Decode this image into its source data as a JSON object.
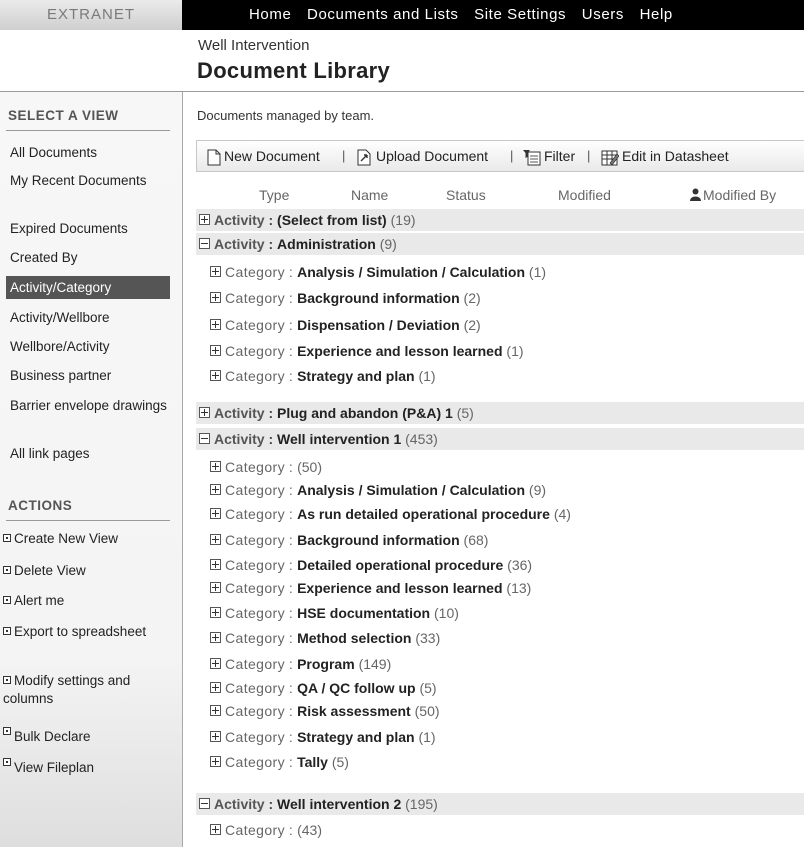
{
  "topbar": {
    "brand": "EXTRANET",
    "nav": [
      "Home",
      "Documents and Lists",
      "Site Settings",
      "Users",
      "Help"
    ]
  },
  "header": {
    "site_name": "Well Intervention",
    "page_title": "Document Library"
  },
  "sidebar": {
    "views_heading": "SELECT A VIEW",
    "views": [
      "All Documents",
      "My Recent Documents",
      "Expired Documents",
      "Created By",
      "Activity/Category",
      "Activity/Wellbore",
      "Wellbore/Activity",
      "Business partner",
      "Barrier envelope drawings",
      "All link pages"
    ],
    "selected_view": "Activity/Category",
    "actions_heading": "ACTIONS",
    "actions": [
      "Create New View",
      "Delete View",
      "Alert me",
      "Export to spreadsheet",
      "Modify settings and columns",
      "Bulk Declare",
      "View Fileplan"
    ]
  },
  "main": {
    "description": "Documents managed by team.",
    "toolbar": {
      "new_document": "New Document",
      "upload_document": "Upload Document",
      "filter": "Filter",
      "edit_datasheet": "Edit in Datasheet",
      "separator": "|"
    },
    "columns": [
      "Type",
      "Name",
      "Status",
      "Modified",
      "Modified By"
    ],
    "group_labels": {
      "activity": "Activity",
      "category": "Category",
      "colon": ":"
    },
    "groups": [
      {
        "level": "activity",
        "expanded": false,
        "name": "(Select from list)",
        "count": "(19)"
      },
      {
        "level": "activity",
        "expanded": true,
        "name": "Administration",
        "count": "(9)"
      },
      {
        "level": "category",
        "expanded": false,
        "name": "Analysis / Simulation / Calculation",
        "count": "(1)"
      },
      {
        "level": "category",
        "expanded": false,
        "name": "Background information",
        "count": "(2)"
      },
      {
        "level": "category",
        "expanded": false,
        "name": "Dispensation / Deviation",
        "count": "(2)"
      },
      {
        "level": "category",
        "expanded": false,
        "name": "Experience and lesson learned",
        "count": "(1)"
      },
      {
        "level": "category",
        "expanded": false,
        "name": "Strategy and plan",
        "count": "(1)"
      },
      {
        "level": "activity",
        "expanded": false,
        "name": "Plug and abandon (P&A) 1",
        "count": "(5)"
      },
      {
        "level": "activity",
        "expanded": true,
        "name": "Well intervention 1",
        "count": "(453)"
      },
      {
        "level": "category",
        "expanded": false,
        "name": "",
        "count": "(50)"
      },
      {
        "level": "category",
        "expanded": false,
        "name": "Analysis / Simulation / Calculation",
        "count": "(9)"
      },
      {
        "level": "category",
        "expanded": false,
        "name": "As run detailed operational procedure",
        "count": "(4)"
      },
      {
        "level": "category",
        "expanded": false,
        "name": "Background information",
        "count": "(68)"
      },
      {
        "level": "category",
        "expanded": false,
        "name": "Detailed operational procedure",
        "count": "(36)"
      },
      {
        "level": "category",
        "expanded": false,
        "name": "Experience and lesson learned",
        "count": "(13)"
      },
      {
        "level": "category",
        "expanded": false,
        "name": "HSE documentation",
        "count": "(10)"
      },
      {
        "level": "category",
        "expanded": false,
        "name": "Method selection",
        "count": "(33)"
      },
      {
        "level": "category",
        "expanded": false,
        "name": "Program",
        "count": "(149)"
      },
      {
        "level": "category",
        "expanded": false,
        "name": "QA / QC follow up",
        "count": "(5)"
      },
      {
        "level": "category",
        "expanded": false,
        "name": "Risk assessment",
        "count": "(50)"
      },
      {
        "level": "category",
        "expanded": false,
        "name": "Strategy and plan",
        "count": "(1)"
      },
      {
        "level": "category",
        "expanded": false,
        "name": "Tally",
        "count": "(5)"
      },
      {
        "level": "activity",
        "expanded": true,
        "name": "Well intervention 2",
        "count": "(195)"
      },
      {
        "level": "category",
        "expanded": false,
        "name": "",
        "count": "(43)"
      }
    ]
  }
}
